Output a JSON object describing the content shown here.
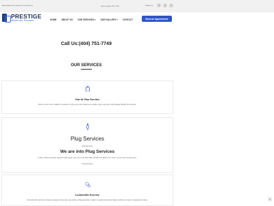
{
  "topbar": {
    "left_text": "Best Mobile Tire Service for Customers",
    "phone_text": "Call Us:(404) 751-7749",
    "follow_label": "Follow Us:",
    "social_icons": [
      "facebook-icon",
      "twitter-icon",
      "instagram-icon"
    ]
  },
  "header": {
    "logo_main": "PRESTIGE",
    "logo_sub": "Mobile tire Services",
    "nav": [
      "HOME",
      "ABOUT US",
      "OUR SERVICES",
      "OUR GALLERY",
      "CONTACT"
    ],
    "cta_label": "Book an Appointment"
  },
  "main": {
    "call_heading": "Call Us:(404) 751-7749",
    "services_heading": "OUR SERVICES"
  },
  "services": [
    {
      "icon": "gas-can-icon",
      "title": "Out of Gas Service",
      "text": "When you're in the middle of nowhere or when you can't locate any another way to get gas, call Prestige Mobile Tire Service."
    },
    {
      "icon": "plug-icon",
      "title": "Plug Services",
      "breadcrumb": "Plug Services",
      "subtitle": "We are into Plug Services",
      "text": "In fact, without properly working spark plugs, your car more than likely wouldn't be able to run at all. Let us meet its plug more.",
      "tag": "Plug Services"
    },
    {
      "icon": "gears-icon",
      "title": "Locksmith Service",
      "text": "Our locksmith services include emergency lock outs, key cutting, changing locks, repairs to automotive locks helping without car keys & replacement keys."
    }
  ],
  "scroll_top_icon": "chevron-up-icon"
}
